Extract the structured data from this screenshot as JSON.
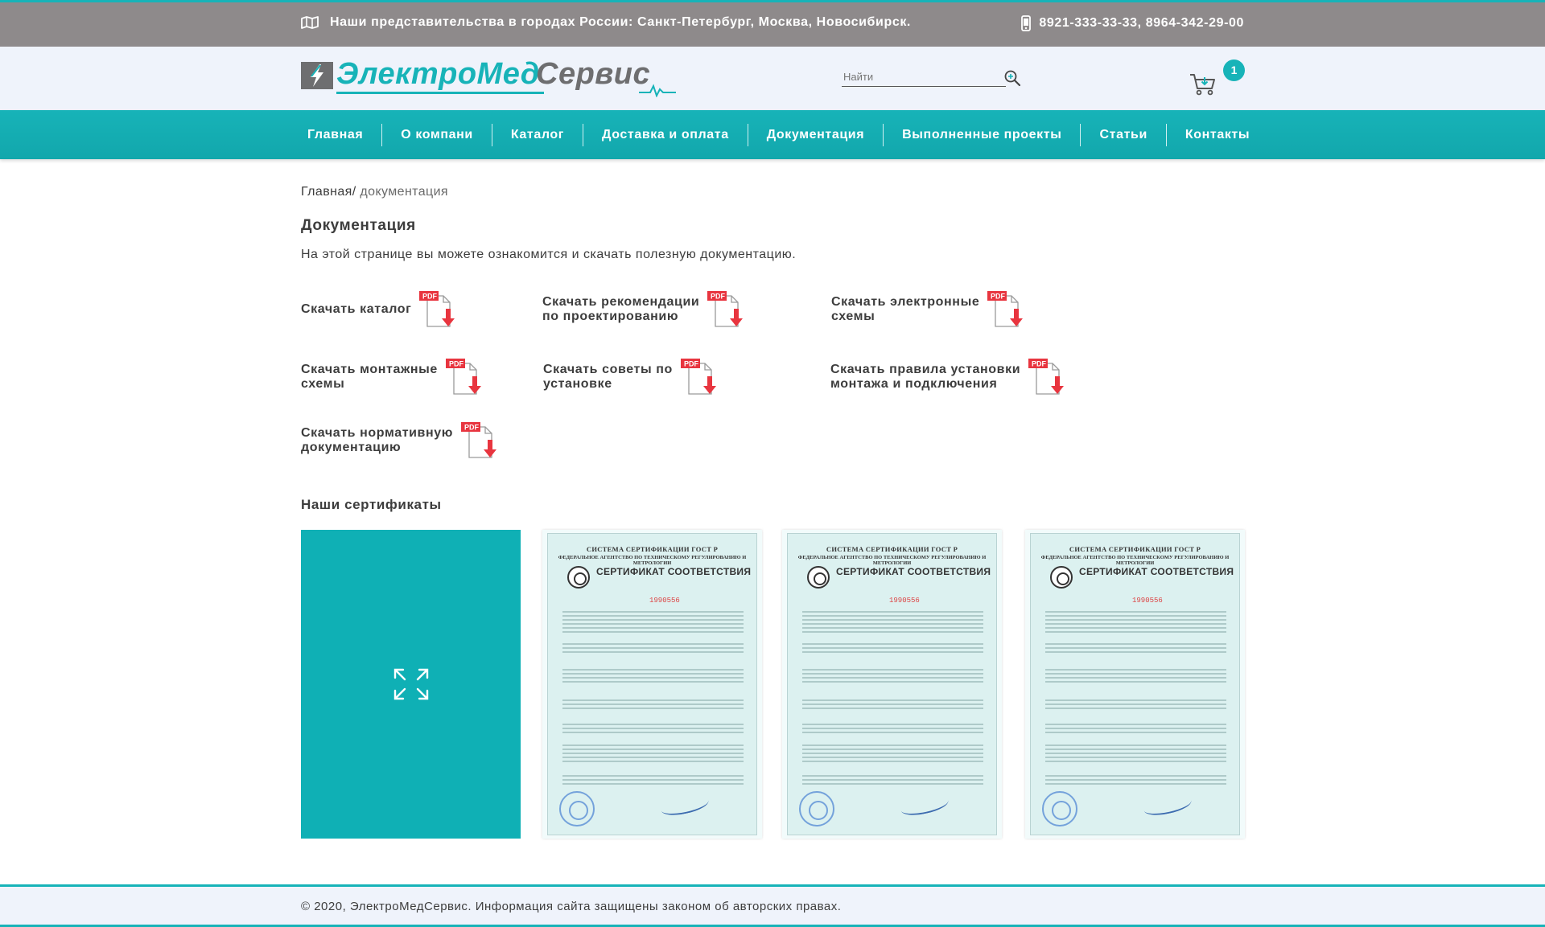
{
  "topbar": {
    "offices": "Наши представительства в городах России: Санкт-Петербург, Москва, Новосибирск.",
    "phones": "8921-333-33-33, 8964-342-29-00",
    "map_icon": "map-icon",
    "phone_icon": "phone-icon"
  },
  "header": {
    "logo_part1": "ЭлектроМед",
    "logo_part2": "Сервис",
    "search_placeholder": "Найти",
    "cart_count": "1"
  },
  "nav": {
    "items": [
      {
        "label": "Главная"
      },
      {
        "label": "О компани"
      },
      {
        "label": "Каталог"
      },
      {
        "label": "Доставка и оплата"
      },
      {
        "label": "Документация"
      },
      {
        "label": "Выполненные проекты"
      },
      {
        "label": "Статьи"
      },
      {
        "label": "Контакты"
      }
    ]
  },
  "breadcrumb": {
    "home": "Главная",
    "sep": "/ ",
    "current": "документация"
  },
  "page": {
    "title": "Документация",
    "intro": "На этой странице вы можете ознакомится и скачать полезную документацию."
  },
  "downloads": [
    {
      "line1": "Скачать каталог",
      "line2": ""
    },
    {
      "line1": "Скачать рекомендации",
      "line2": "по проектированию"
    },
    {
      "line1": "Скачать электронные",
      "line2": "схемы"
    },
    {
      "line1": "Скачать монтажные",
      "line2": "схемы"
    },
    {
      "line1": "Скачать советы по",
      "line2": "установке"
    },
    {
      "line1": "Скачать правила установки",
      "line2": "монтажа и подключения"
    },
    {
      "line1": "Скачать нормативную",
      "line2": "документацию"
    }
  ],
  "pdf_badge": "PDF",
  "certificates": {
    "title": "Наши сертификаты",
    "doc_header": "СИСТЕМА СЕРТИФИКАЦИИ ГОСТ Р",
    "doc_agency": "ФЕДЕРАЛЬНОЕ АГЕНТСТВО ПО ТЕХНИЧЕСКОМУ РЕГУЛИРОВАНИЮ И МЕТРОЛОГИИ",
    "doc_title": "СЕРТИФИКАТ СООТВЕТСТВИЯ",
    "doc_number": "1990556"
  },
  "footer": {
    "copyright": "© 2020, ЭлектроМедСервис. Информация сайта защищены законом об авторских правах."
  },
  "colors": {
    "accent": "#17b3b8",
    "topbar": "#8e8a8b",
    "header_bg": "#eff3fb",
    "pdf_red": "#e8353f"
  }
}
